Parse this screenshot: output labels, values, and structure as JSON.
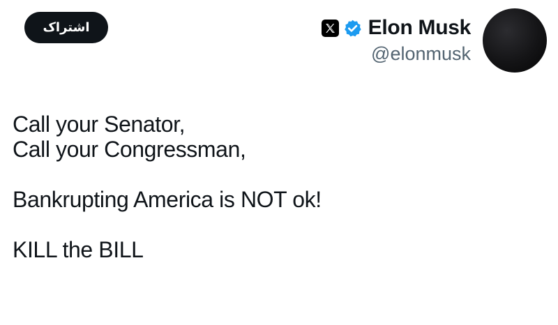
{
  "subscribe": {
    "label": "اشتراک"
  },
  "author": {
    "display_name": "Elon Musk",
    "handle": "@elonmusk",
    "platform_icon": "x-logo-icon",
    "verified_icon": "verified-badge-icon",
    "verified_color": "#1d9bf0"
  },
  "tweet": {
    "lines": [
      "Call your Senator,",
      "Call your Congressman,",
      "Bankrupting America is NOT ok!",
      "KILL the BILL"
    ]
  },
  "colors": {
    "text_primary": "#0f1419",
    "text_secondary": "#536471",
    "button_background": "#0f1419"
  }
}
